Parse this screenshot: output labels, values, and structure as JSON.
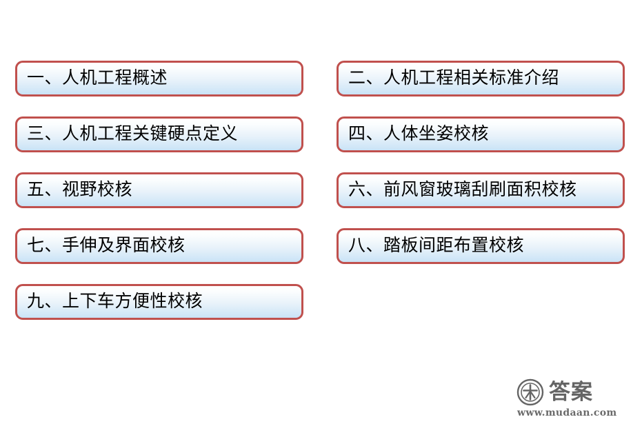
{
  "slide": {
    "background_color": "#ffffff",
    "box_border_color": "#c0504d",
    "box_fill_top_color": "#ffffff",
    "box_fill_bottom_color": "#c9e2f6",
    "text_color": "#000000"
  },
  "chapters": [
    {
      "label": "一、人机工程概述"
    },
    {
      "label": "二、人机工程相关标准介绍"
    },
    {
      "label": "三、人机工程关键硬点定义"
    },
    {
      "label": "四、人体坐姿校核"
    },
    {
      "label": "五、视野校核"
    },
    {
      "label": "六、前风窗玻璃刮刷面积校核"
    },
    {
      "label": "七、手伸及界面校核"
    },
    {
      "label": "八、踏板间距布置校核"
    },
    {
      "label": "九、上下车方便性校核"
    }
  ],
  "watermark": {
    "seal_icon": "circular-seal-icon",
    "brand": "答案",
    "url": "www.mudaan.com",
    "color": "#595959"
  }
}
